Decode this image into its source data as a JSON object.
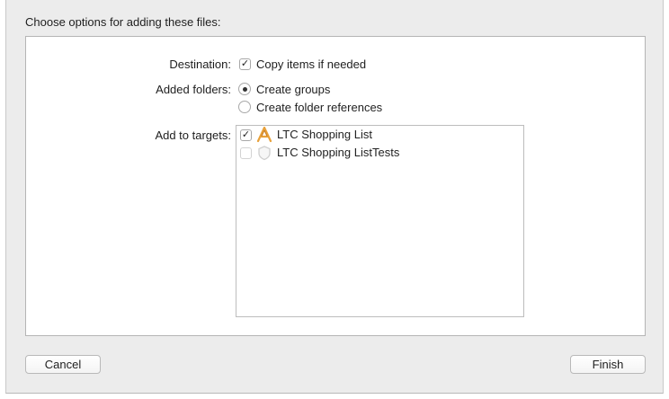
{
  "dialog": {
    "heading": "Choose options for adding these files:",
    "destination": {
      "label": "Destination:",
      "option_label": "Copy items if needed",
      "checked": true
    },
    "added_folders": {
      "label": "Added folders:",
      "options": [
        {
          "label": "Create groups",
          "selected": true
        },
        {
          "label": "Create folder references",
          "selected": false
        }
      ]
    },
    "add_to_targets": {
      "label": "Add to targets:",
      "targets": [
        {
          "name": "LTC Shopping List",
          "checked": true,
          "icon": "app-target-icon",
          "enabled": true
        },
        {
          "name": "LTC Shopping ListTests",
          "checked": false,
          "icon": "test-target-icon",
          "enabled": false
        }
      ]
    },
    "buttons": {
      "cancel": "Cancel",
      "finish": "Finish"
    }
  },
  "colors": {
    "sheet_bg": "#ececec",
    "panel_bg": "#ffffff",
    "border": "#b5b5b5",
    "app_icon_orange": "#e8a13a"
  }
}
